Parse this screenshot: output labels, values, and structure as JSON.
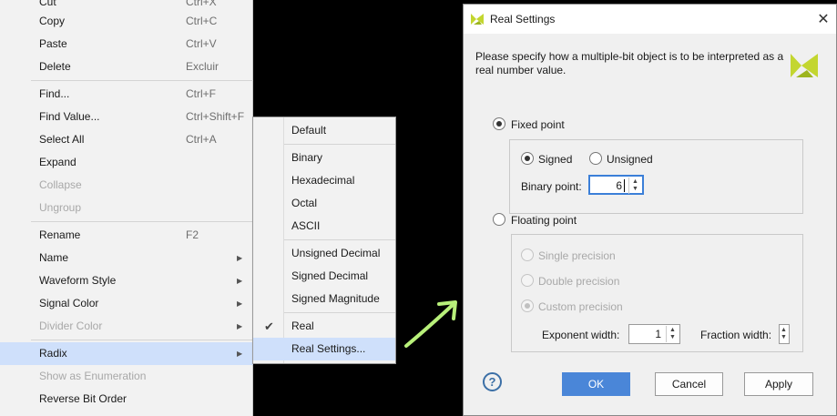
{
  "context_menu": {
    "items": [
      {
        "label": "Cut",
        "shortcut": "Ctrl+X",
        "disabled": false
      },
      {
        "label": "Copy",
        "shortcut": "Ctrl+C",
        "disabled": false
      },
      {
        "label": "Paste",
        "shortcut": "Ctrl+V",
        "disabled": false
      },
      {
        "label": "Delete",
        "shortcut": "Excluir",
        "disabled": false
      },
      {
        "label": "Find...",
        "shortcut": "Ctrl+F",
        "disabled": false
      },
      {
        "label": "Find Value...",
        "shortcut": "Ctrl+Shift+F",
        "disabled": false
      },
      {
        "label": "Select All",
        "shortcut": "Ctrl+A",
        "disabled": false
      },
      {
        "label": "Expand",
        "shortcut": "",
        "disabled": false
      },
      {
        "label": "Collapse",
        "shortcut": "",
        "disabled": true
      },
      {
        "label": "Ungroup",
        "shortcut": "",
        "disabled": true
      },
      {
        "label": "Rename",
        "shortcut": "F2",
        "disabled": false
      },
      {
        "label": "Name",
        "shortcut": "",
        "disabled": false
      },
      {
        "label": "Waveform Style",
        "shortcut": "",
        "disabled": false
      },
      {
        "label": "Signal Color",
        "shortcut": "",
        "disabled": false
      },
      {
        "label": "Divider Color",
        "shortcut": "",
        "disabled": true
      },
      {
        "label": "Radix",
        "shortcut": "",
        "disabled": false
      },
      {
        "label": "Show as Enumeration",
        "shortcut": "",
        "disabled": true
      },
      {
        "label": "Reverse Bit Order",
        "shortcut": "",
        "disabled": false
      }
    ]
  },
  "radix_menu": {
    "items": [
      {
        "label": "Default"
      },
      {
        "label": "Binary"
      },
      {
        "label": "Hexadecimal"
      },
      {
        "label": "Octal"
      },
      {
        "label": "ASCII"
      },
      {
        "label": "Unsigned Decimal"
      },
      {
        "label": "Signed Decimal"
      },
      {
        "label": "Signed Magnitude"
      },
      {
        "label": "Real",
        "checked": true
      },
      {
        "label": "Real Settings..."
      }
    ]
  },
  "dialog": {
    "title": "Real Settings",
    "close_glyph": "✕",
    "description": "Please specify how a multiple-bit object is to be interpreted as a real number value.",
    "fixed_point": {
      "label": "Fixed point",
      "selected": true,
      "signed_label": "Signed",
      "signed_selected": true,
      "unsigned_label": "Unsigned",
      "binary_point_label": "Binary point:",
      "binary_point_value": "6"
    },
    "floating_point": {
      "label": "Floating point",
      "selected": false,
      "single_label": "Single precision",
      "double_label": "Double precision",
      "custom_label": "Custom precision",
      "custom_selected": true,
      "exponent_label": "Exponent width:",
      "exponent_value": "1",
      "fraction_label": "Fraction width:",
      "fraction_value": ""
    },
    "help_glyph": "?",
    "buttons": {
      "ok": "OK",
      "cancel": "Cancel",
      "apply": "Apply"
    }
  },
  "colors": {
    "menu_highlight": "#cfe0fb",
    "ok_button": "#4a86d8",
    "arrow": "#b8f07a",
    "logo": "#c3d630"
  },
  "icons": {
    "check": "✔",
    "submenu_arrow": "▶",
    "spin_up": "▲",
    "spin_down": "▼"
  }
}
